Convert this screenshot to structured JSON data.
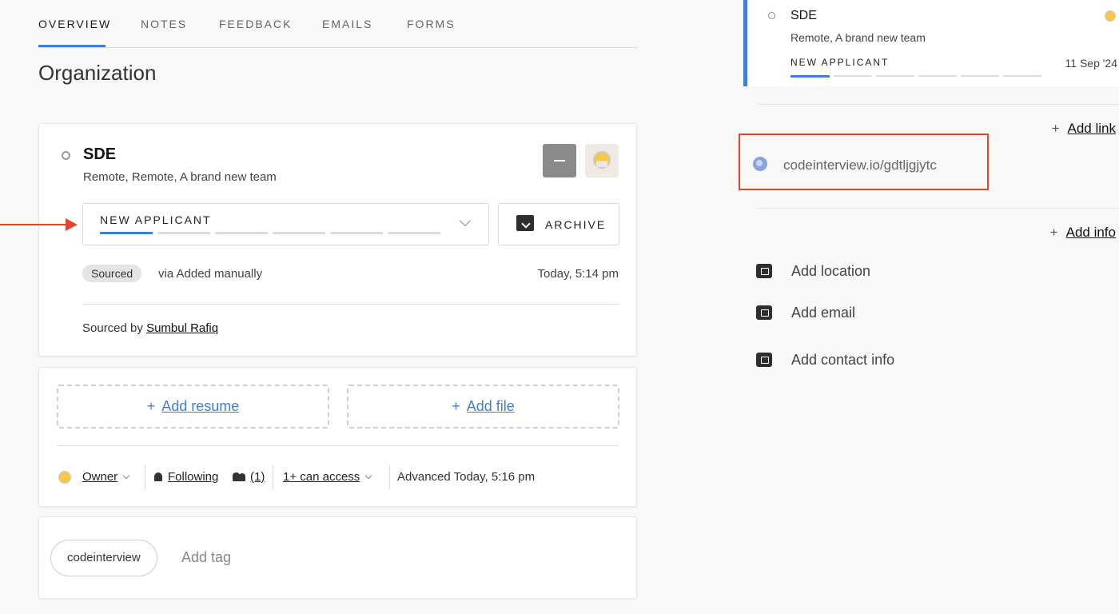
{
  "tabs": [
    "OVERVIEW",
    "NOTES",
    "FEEDBACK",
    "EMAILS",
    "FORMS"
  ],
  "page_title": "Organization",
  "opportunity": {
    "title": "SDE",
    "subtitle": "Remote, Remote, A brand new team",
    "stage": "NEW APPLICANT",
    "archive_label": "ARCHIVE",
    "source_badge": "Sourced",
    "source_via": "via Added manually",
    "source_time": "Today, 5:14 pm",
    "sourced_by_label": "Sourced by",
    "sourced_by_name": "Sumbul Rafiq"
  },
  "files": {
    "add_resume": "Add resume",
    "add_file": "Add file",
    "plus": "+"
  },
  "meta": {
    "owner": "Owner",
    "following": "Following",
    "followers": "(1)",
    "access": "1+ can access",
    "advanced": "Advanced Today, 5:16 pm"
  },
  "tags": {
    "chip": "codeinterview",
    "add_placeholder": "Add tag"
  },
  "side_application": {
    "title": "SDE",
    "subtitle": "Remote, A brand new team",
    "stage": "NEW APPLICANT",
    "date": "11 Sep '24"
  },
  "links": {
    "add_link": "Add link",
    "url": "codeinterview.io/gdtljgjytc"
  },
  "info": {
    "add_info": "Add info",
    "location": "Add location",
    "email": "Add email",
    "contact": "Add contact info"
  },
  "colors": {
    "accent": "#3d7fd9",
    "annotation_red": "#e0462c"
  },
  "stage_progress": {
    "segments": 6,
    "completed": 1
  }
}
